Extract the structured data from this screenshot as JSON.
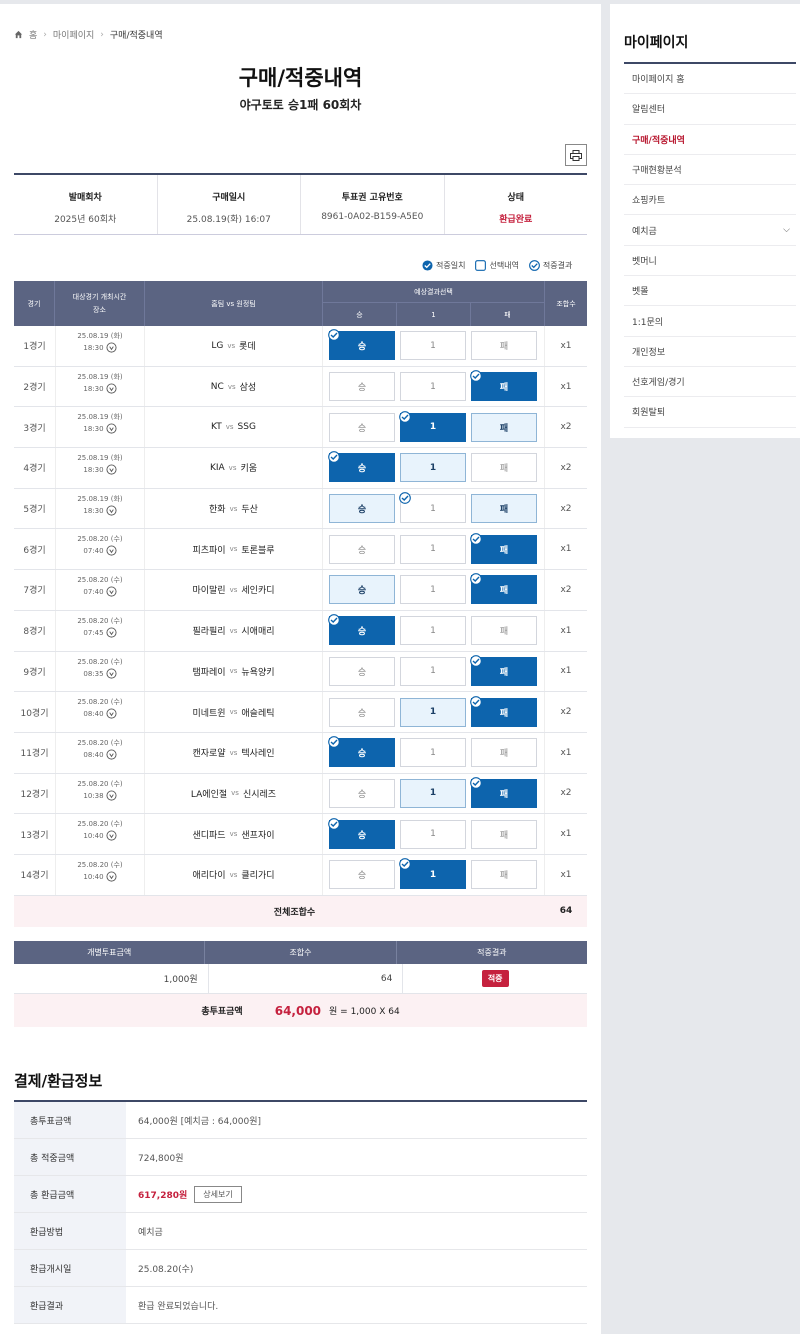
{
  "breadcrumb": {
    "home": "홈",
    "mypage": "마이페이지",
    "current": "구매/적중내역"
  },
  "page": {
    "title": "구매/적중내역",
    "subtitle": "야구토토 승1패 60회차"
  },
  "info": {
    "headers": [
      "발매회차",
      "구매일시",
      "투표권 고유번호",
      "상태"
    ],
    "values": [
      "2025년 60회차",
      "25.08.19(화) 16:07",
      "8961-0A02-B159-A5E0",
      "환급완료"
    ]
  },
  "legend": {
    "hit": "적중일치",
    "selected": "선택내역",
    "result": "적중결과"
  },
  "grid": {
    "headers": {
      "no": "경기",
      "time": "대상경기 개최시간\n장소",
      "teams": "홈팀 vs 원정팀",
      "pick": "예상결과선택",
      "pick_w": "승",
      "pick_d": "1",
      "pick_l": "패",
      "mul": "조합수"
    },
    "vs": "vs",
    "rows": [
      {
        "no": "1경기",
        "date": "25.08.19 (화)",
        "time": "18:30",
        "home": "LG",
        "away": "롯데",
        "mul": "x1",
        "w": "sel",
        "d": "",
        "l": "",
        "chk": "w"
      },
      {
        "no": "2경기",
        "date": "25.08.19 (화)",
        "time": "18:30",
        "home": "NC",
        "away": "삼성",
        "mul": "x1",
        "w": "",
        "d": "",
        "l": "sel",
        "chk": "l"
      },
      {
        "no": "3경기",
        "date": "25.08.19 (화)",
        "time": "18:30",
        "home": "KT",
        "away": "SSG",
        "mul": "x2",
        "w": "",
        "d": "sel",
        "l": "lt",
        "chk": "d"
      },
      {
        "no": "4경기",
        "date": "25.08.19 (화)",
        "time": "18:30",
        "home": "KIA",
        "away": "키움",
        "mul": "x2",
        "w": "sel",
        "d": "lt",
        "l": "",
        "chk": "w"
      },
      {
        "no": "5경기",
        "date": "25.08.19 (화)",
        "time": "18:30",
        "home": "한화",
        "away": "두산",
        "mul": "x2",
        "w": "lt",
        "d": "",
        "l": "lt",
        "chk": "d"
      },
      {
        "no": "6경기",
        "date": "25.08.20 (수)",
        "time": "07:40",
        "home": "피츠파이",
        "away": "토론블루",
        "mul": "x1",
        "w": "",
        "d": "",
        "l": "sel",
        "chk": "l"
      },
      {
        "no": "7경기",
        "date": "25.08.20 (수)",
        "time": "07:40",
        "home": "마이말린",
        "away": "세인카디",
        "mul": "x2",
        "w": "lt",
        "d": "",
        "l": "sel",
        "chk": "l"
      },
      {
        "no": "8경기",
        "date": "25.08.20 (수)",
        "time": "07:45",
        "home": "필라필리",
        "away": "시애매리",
        "mul": "x1",
        "w": "sel",
        "d": "",
        "l": "",
        "chk": "w"
      },
      {
        "no": "9경기",
        "date": "25.08.20 (수)",
        "time": "08:35",
        "home": "탬파레이",
        "away": "뉴욕양키",
        "mul": "x1",
        "w": "",
        "d": "",
        "l": "sel",
        "chk": "l"
      },
      {
        "no": "10경기",
        "date": "25.08.20 (수)",
        "time": "08:40",
        "home": "미네트윈",
        "away": "애슬레틱",
        "mul": "x2",
        "w": "",
        "d": "lt",
        "l": "sel",
        "chk": "l"
      },
      {
        "no": "11경기",
        "date": "25.08.20 (수)",
        "time": "08:40",
        "home": "캔자로얄",
        "away": "텍사레인",
        "mul": "x1",
        "w": "sel",
        "d": "",
        "l": "",
        "chk": "w"
      },
      {
        "no": "12경기",
        "date": "25.08.20 (수)",
        "time": "10:38",
        "home": "LA에인절",
        "away": "신시레즈",
        "mul": "x2",
        "w": "",
        "d": "lt",
        "l": "sel",
        "chk": "l"
      },
      {
        "no": "13경기",
        "date": "25.08.20 (수)",
        "time": "10:40",
        "home": "샌디파드",
        "away": "샌프자이",
        "mul": "x1",
        "w": "sel",
        "d": "",
        "l": "",
        "chk": "w"
      },
      {
        "no": "14경기",
        "date": "25.08.20 (수)",
        "time": "10:40",
        "home": "애리다이",
        "away": "클리가디",
        "mul": "x1",
        "w": "",
        "d": "sel",
        "l": "",
        "chk": "d"
      }
    ],
    "total_label": "전체조합수",
    "total_value": "64"
  },
  "summary": {
    "headers": [
      "개별투표금액",
      "조합수",
      "적중결과"
    ],
    "amount": "1,000원",
    "combos": "64",
    "result": "적중",
    "total_label": "총투표금액",
    "total_amount": "64,000",
    "total_formula": "원 = 1,000 X 64"
  },
  "payment": {
    "title": "결제/환급정보",
    "rows": [
      {
        "k": "총투표금액",
        "v": "64,000원 [예치금 : 64,000원]"
      },
      {
        "k": "총 적중금액",
        "v": "724,800원"
      },
      {
        "k": "총 환급금액",
        "v": "617,280원",
        "btn": "상세보기"
      },
      {
        "k": "환급방법",
        "v": "예치금"
      },
      {
        "k": "환급개시일",
        "v": "25.08.20(수)"
      },
      {
        "k": "환급결과",
        "v": "환급 완료되었습니다."
      }
    ]
  },
  "sidebar": {
    "title": "마이페이지",
    "items": [
      "마이페이지 홈",
      "알림센터",
      "구매/적중내역",
      "구매현황분석",
      "쇼핑카트",
      "예치금",
      "벳머니",
      "벳몰",
      "1:1문의",
      "개인정보",
      "선호게임/경기",
      "회원탈퇴"
    ],
    "active_index": 2
  },
  "colors": {
    "primary": "#0d64ad",
    "header": "#5b6482",
    "accent": "#c5213e"
  }
}
